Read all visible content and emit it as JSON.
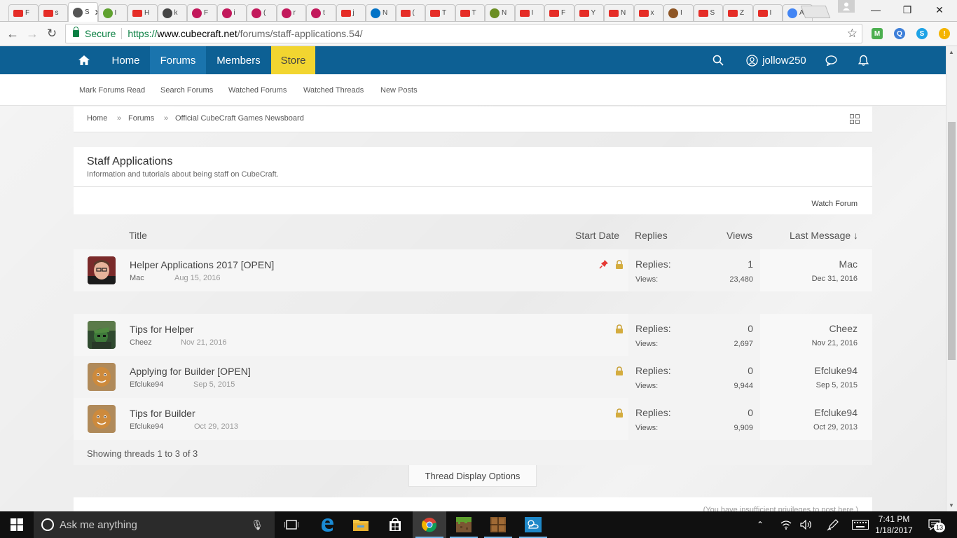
{
  "browser": {
    "tabs": [
      {
        "label": "F",
        "favicon": "youtube-icon"
      },
      {
        "label": "s",
        "favicon": "youtube-icon"
      },
      {
        "label": "S",
        "favicon": "cubecraft-icon",
        "active": true
      },
      {
        "label": "I",
        "favicon": "green-app-icon"
      },
      {
        "label": "H",
        "favicon": "youtube-icon"
      },
      {
        "label": "k",
        "favicon": "pixel-icon"
      },
      {
        "label": "F",
        "favicon": "flower-icon"
      },
      {
        "label": "i",
        "favicon": "flower-icon"
      },
      {
        "label": "(",
        "favicon": "flower-icon"
      },
      {
        "label": "r",
        "favicon": "flower-icon"
      },
      {
        "label": "t",
        "favicon": "flower-icon"
      },
      {
        "label": "j",
        "favicon": "youtube-icon"
      },
      {
        "label": "N",
        "favicon": "outlook-icon"
      },
      {
        "label": "(",
        "favicon": "youtube-icon"
      },
      {
        "label": "T",
        "favicon": "youtube-icon"
      },
      {
        "label": "T",
        "favicon": "youtube-icon"
      },
      {
        "label": "N",
        "favicon": "minecraft-icon"
      },
      {
        "label": "I",
        "favicon": "youtube-icon"
      },
      {
        "label": "F",
        "favicon": "youtube-icon"
      },
      {
        "label": "Y",
        "favicon": "youtube-icon"
      },
      {
        "label": "N",
        "favicon": "youtube-icon"
      },
      {
        "label": "x",
        "favicon": "youtube-icon"
      },
      {
        "label": "I",
        "favicon": "face-icon"
      },
      {
        "label": "S",
        "favicon": "youtube-icon"
      },
      {
        "label": "Z",
        "favicon": "youtube-icon"
      },
      {
        "label": "I",
        "favicon": "youtube-icon"
      },
      {
        "label": "A",
        "favicon": "loading-icon"
      }
    ],
    "active_tab_close": "✕",
    "address": {
      "secure_label": "Secure",
      "url_scheme": "https://",
      "url_host": "www.cubecraft.net",
      "url_path": "/forums/staff-applications.54/"
    }
  },
  "site_nav": {
    "items": [
      "Home",
      "Forums",
      "Members",
      "Store"
    ],
    "active": "Forums",
    "username": "jollow250"
  },
  "sub_nav": [
    "Mark Forums Read",
    "Search Forums",
    "Watched Forums",
    "Watched Threads",
    "New Posts"
  ],
  "breadcrumb": {
    "items": [
      "Home",
      "Forums",
      "Official CubeCraft Games Newsboard"
    ],
    "separator": "»"
  },
  "forum": {
    "title": "Staff Applications",
    "description": "Information and tutorials about being staff on CubeCraft.",
    "watch_label": "Watch Forum"
  },
  "columns": {
    "title": "Title",
    "start_date": "Start Date",
    "replies": "Replies",
    "views": "Views",
    "last_message": "Last Message ↓"
  },
  "threads": [
    {
      "title": "Helper Applications 2017 [OPEN]",
      "author": "Mac",
      "date": "Aug 15, 2016",
      "sticky": true,
      "locked": true,
      "replies_label": "Replies:",
      "replies": "1",
      "views_label": "Views:",
      "views": "23,480",
      "last_user": "Mac",
      "last_date": "Dec 31, 2016"
    },
    {
      "title": "Tips for Helper",
      "author": "Cheez",
      "date": "Nov 21, 2016",
      "sticky": false,
      "locked": true,
      "replies_label": "Replies:",
      "replies": "0",
      "views_label": "Views:",
      "views": "2,697",
      "last_user": "Cheez",
      "last_date": "Nov 21, 2016"
    },
    {
      "title": "Applying for Builder [OPEN]",
      "author": "Efcluke94",
      "date": "Sep 5, 2015",
      "sticky": false,
      "locked": true,
      "replies_label": "Replies:",
      "replies": "0",
      "views_label": "Views:",
      "views": "9,944",
      "last_user": "Efcluke94",
      "last_date": "Sep 5, 2015"
    },
    {
      "title": "Tips for Builder",
      "author": "Efcluke94",
      "date": "Oct 29, 2013",
      "sticky": false,
      "locked": true,
      "replies_label": "Replies:",
      "replies": "0",
      "views_label": "Views:",
      "views": "9,909",
      "last_user": "Efcluke94",
      "last_date": "Oct 29, 2013"
    }
  ],
  "showing_text": "Showing threads 1 to 3 of 3",
  "display_options_label": "Thread Display Options",
  "footer_partial": "(You have insufficient privileges to post here.)",
  "taskbar": {
    "search_placeholder": "Ask me anything",
    "time": "7:41 PM",
    "date": "1/18/2017",
    "notifications": "13"
  },
  "colors": {
    "nav_blue": "#0d6094",
    "nav_active": "#1a74ad",
    "store_yellow": "#f2d530",
    "secure_green": "#0b8043"
  }
}
